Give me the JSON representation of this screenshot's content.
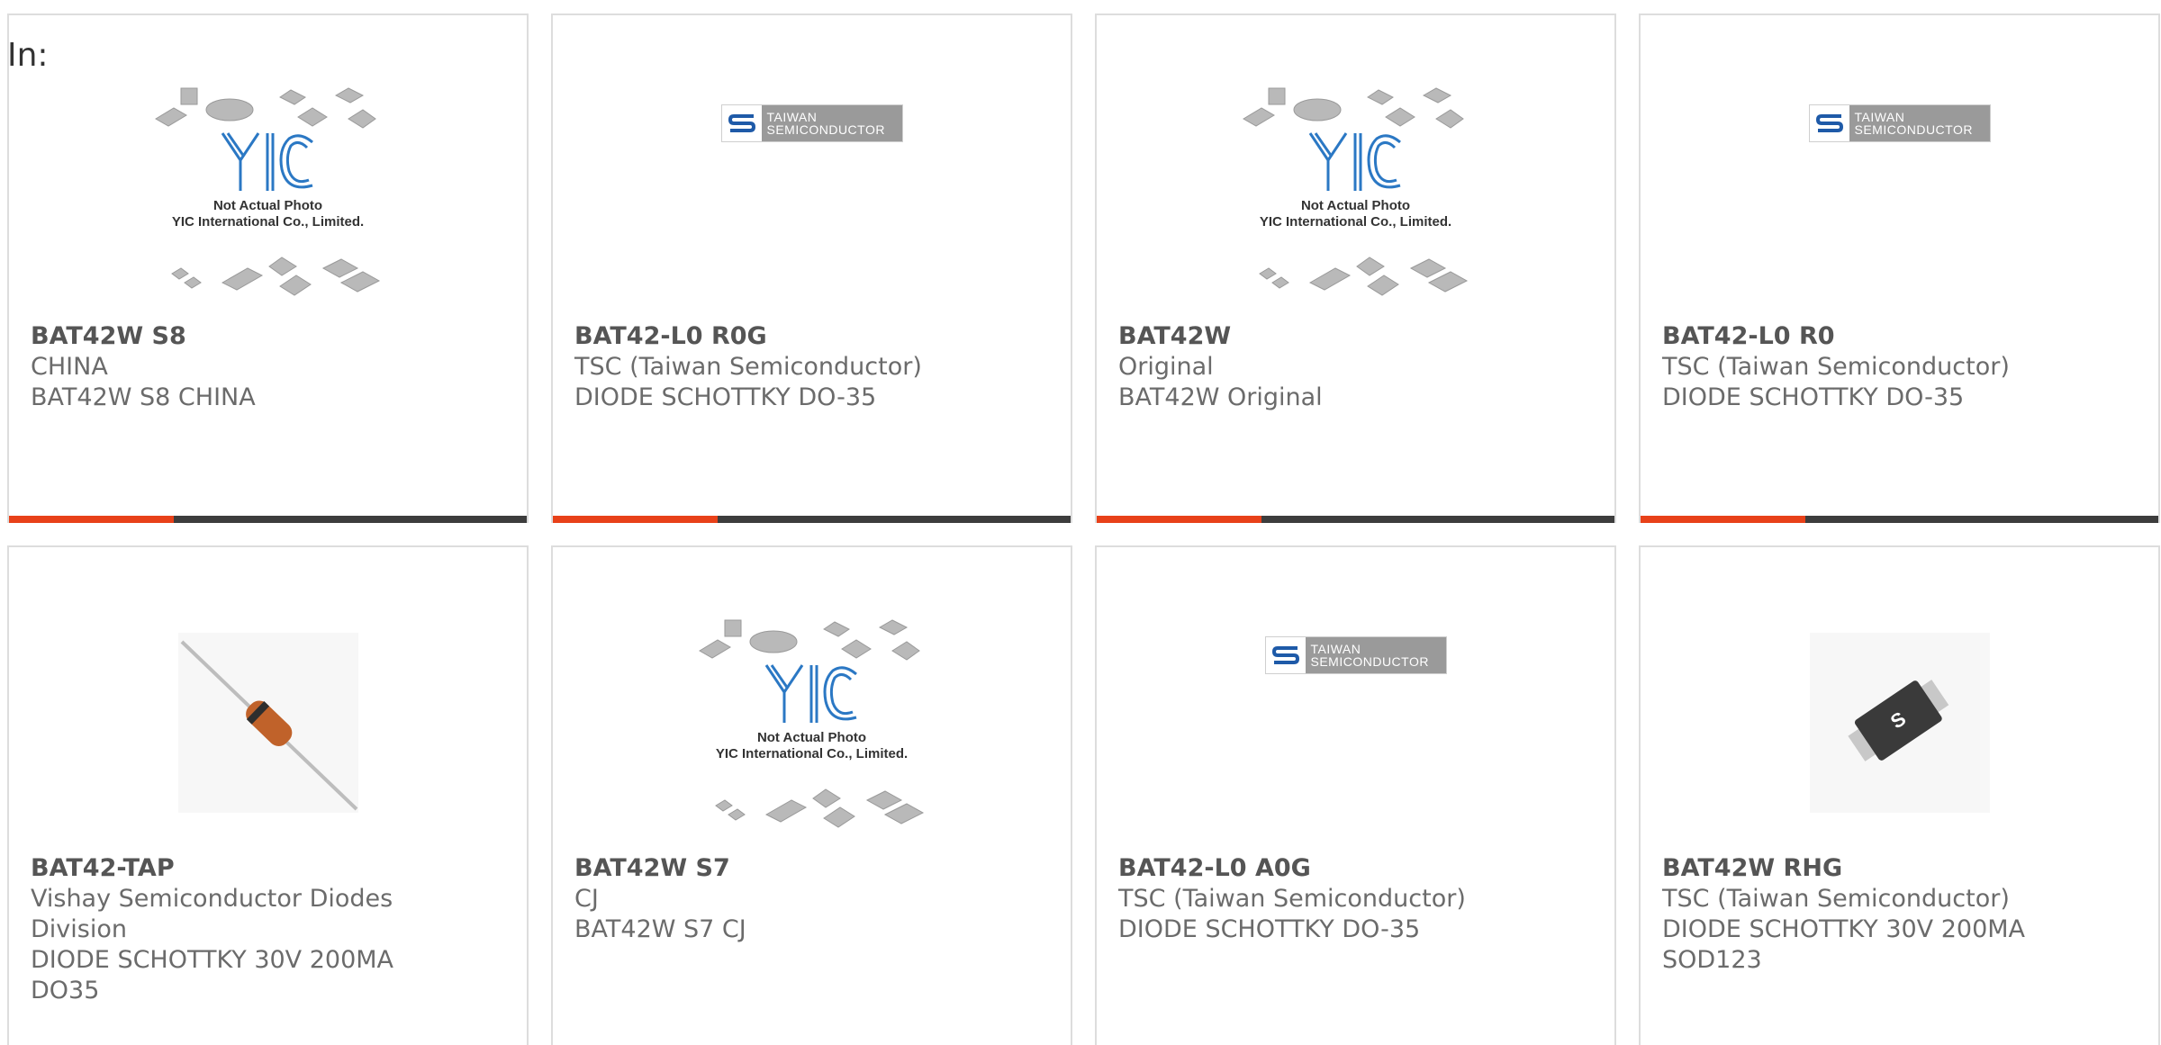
{
  "page": {
    "in_label": "In:"
  },
  "colors": {
    "accent": "#e84119",
    "bar": "#3d3d3d",
    "border": "#dddddd",
    "text_primary": "#555555",
    "text_secondary": "#6b6b6b"
  },
  "cards": [
    {
      "part": "BAT42W S8",
      "maker": "CHINA",
      "desc": "BAT42W S8 CHINA",
      "image": "yic-not-actual-photo",
      "image_caption_1": "Not Actual Photo",
      "image_caption_2": "YIC International Co., Limited.",
      "logo_text": "YIC"
    },
    {
      "part": "BAT42-L0 R0G",
      "maker": "TSC (Taiwan Semiconductor)",
      "desc": "DIODE SCHOTTKY DO-35",
      "image": "taiwan-semiconductor-logo",
      "logo_line_1": "TAIWAN",
      "logo_line_2": "SEMICONDUCTOR"
    },
    {
      "part": "BAT42W",
      "maker": "Original",
      "desc": "BAT42W Original",
      "image": "yic-not-actual-photo",
      "image_caption_1": "Not Actual Photo",
      "image_caption_2": "YIC International Co., Limited.",
      "logo_text": "YIC"
    },
    {
      "part": "BAT42-L0 R0",
      "maker": "TSC (Taiwan Semiconductor)",
      "desc": "DIODE SCHOTTKY DO-35",
      "image": "taiwan-semiconductor-logo",
      "logo_line_1": "TAIWAN",
      "logo_line_2": "SEMICONDUCTOR"
    },
    {
      "part": "BAT42-TAP",
      "maker_line_1": "Vishay Semiconductor Diodes",
      "maker_line_2": "Division",
      "desc_line_1": "DIODE SCHOTTKY 30V 200MA",
      "desc_line_2": "DO35",
      "image": "axial-diode-photo"
    },
    {
      "part": "BAT42W S7",
      "maker": "CJ",
      "desc": "BAT42W S7 CJ",
      "image": "yic-not-actual-photo",
      "image_caption_1": "Not Actual Photo",
      "image_caption_2": "YIC International Co., Limited.",
      "logo_text": "YIC"
    },
    {
      "part": "BAT42-L0 A0G",
      "maker": "TSC (Taiwan Semiconductor)",
      "desc": "DIODE SCHOTTKY DO-35",
      "image": "taiwan-semiconductor-logo",
      "logo_line_1": "TAIWAN",
      "logo_line_2": "SEMICONDUCTOR"
    },
    {
      "part": "BAT42W RHG",
      "maker": "TSC (Taiwan Semiconductor)",
      "desc_line_1": "DIODE SCHOTTKY 30V 200MA",
      "desc_line_2": "SOD123",
      "image": "sod123-package-photo",
      "package_mark": "S"
    }
  ]
}
